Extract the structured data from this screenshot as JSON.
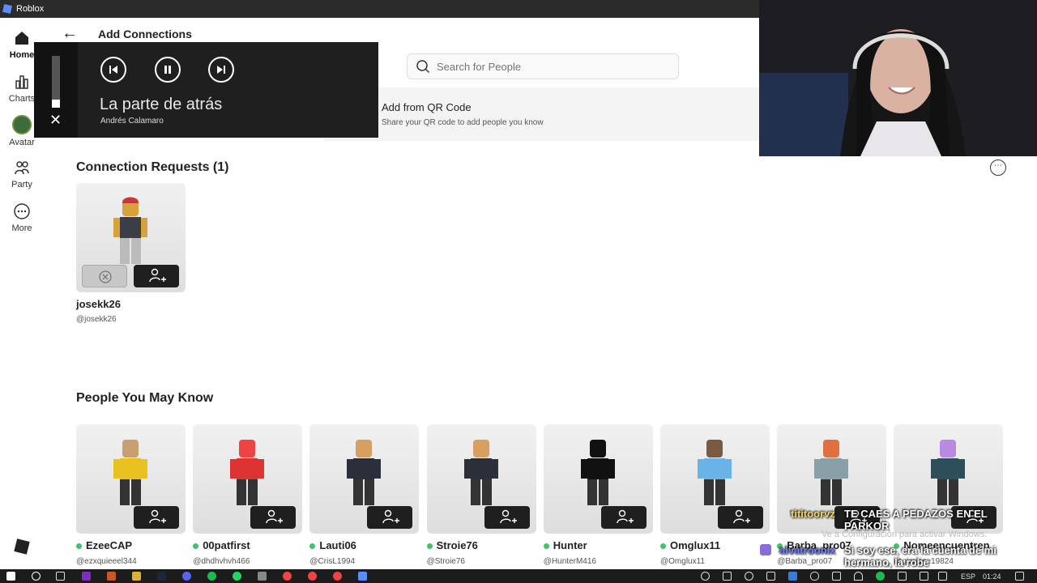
{
  "window": {
    "title": "Roblox"
  },
  "sidebar": {
    "items": [
      {
        "label": "Home"
      },
      {
        "label": "Charts"
      },
      {
        "label": "Avatar"
      },
      {
        "label": "Party"
      },
      {
        "label": "More"
      }
    ]
  },
  "header": {
    "title": "Add Connections"
  },
  "search": {
    "placeholder": "Search for People"
  },
  "qr": {
    "title": "Add from QR Code",
    "subtitle": "Share your QR code to add people you know"
  },
  "media": {
    "song": "La parte de atrás",
    "artist": "Andrés Calamaro"
  },
  "requests": {
    "title": "Connection Requests (1)",
    "items": [
      {
        "name": "josekk26",
        "handle": "@josekk26"
      }
    ]
  },
  "people": {
    "title": "People You May Know",
    "items": [
      {
        "name": "EzeeCAP",
        "handle": "@ezxquieeel344"
      },
      {
        "name": "00patfirst",
        "handle": "@dhdhvhvh466"
      },
      {
        "name": "Lauti06",
        "handle": "@CrisL1994"
      },
      {
        "name": "Stroie76",
        "handle": "@Stroie76"
      },
      {
        "name": "Hunter",
        "handle": "@HunterM416"
      },
      {
        "name": "Omglux11",
        "handle": "@Omglux11"
      },
      {
        "name": "Barba_pro07",
        "handle": "@Barba_pro07"
      },
      {
        "name": "Nomeencuentren",
        "handle": "@giorgine19824"
      }
    ]
  },
  "overlay": {
    "chat1_user": "tititoorvz",
    "chat1_msg": "TE CAES A PEDAZOS EN EL PARKOR",
    "chat2_user": "alvatroonix",
    "chat2_msg": "Si soy ese, era la cuenta de mi hermano, la robe",
    "watermark": "Ve a Configuración para activar Windows."
  },
  "taskbar": {
    "lang": "ESP",
    "time": "01:24"
  }
}
